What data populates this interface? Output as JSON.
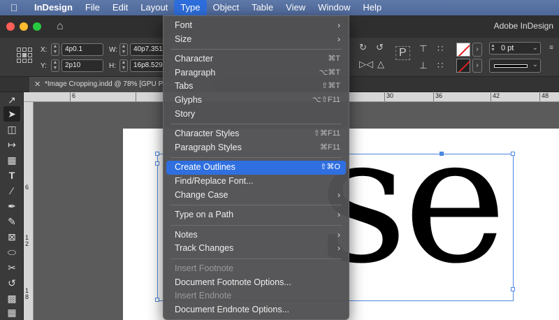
{
  "menubar": {
    "apple": "",
    "items": [
      "InDesign",
      "File",
      "Edit",
      "Layout",
      "Type",
      "Object",
      "Table",
      "View",
      "Window",
      "Help"
    ],
    "active": "Type"
  },
  "titlebar": {
    "app_title": "Adobe InDesign"
  },
  "control": {
    "x": {
      "label": "X:",
      "value": "4p0.1"
    },
    "y": {
      "label": "Y:",
      "value": "2p10"
    },
    "w": {
      "label": "W:",
      "value": "40p7.351"
    },
    "h": {
      "label": "H:",
      "value": "16p8.529"
    },
    "stroke_weight": "0 pt"
  },
  "tab": {
    "title": "*Image Cropping.indd @ 78% [GPU Preview]"
  },
  "ruler": {
    "top": [
      "6",
      "30",
      "36",
      "42",
      "48"
    ],
    "left": [
      "6",
      "12",
      "18"
    ]
  },
  "type_menu": {
    "items": [
      {
        "label": "Font",
        "shortcut": "",
        "submenu": true,
        "highlighted": false,
        "disabled": false
      },
      {
        "label": "Size",
        "shortcut": "",
        "submenu": true,
        "highlighted": false,
        "disabled": false
      },
      {
        "sep": true
      },
      {
        "label": "Character",
        "shortcut": "⌘T",
        "submenu": false,
        "highlighted": false,
        "disabled": false
      },
      {
        "label": "Paragraph",
        "shortcut": "⌥⌘T",
        "submenu": false,
        "highlighted": false,
        "disabled": false
      },
      {
        "label": "Tabs",
        "shortcut": "⇧⌘T",
        "submenu": false,
        "highlighted": false,
        "disabled": false
      },
      {
        "label": "Glyphs",
        "shortcut": "⌥⇧F11",
        "submenu": false,
        "highlighted": false,
        "disabled": false
      },
      {
        "label": "Story",
        "shortcut": "",
        "submenu": false,
        "highlighted": false,
        "disabled": false
      },
      {
        "sep": true
      },
      {
        "label": "Character Styles",
        "shortcut": "⇧⌘F11",
        "submenu": false,
        "highlighted": false,
        "disabled": false
      },
      {
        "label": "Paragraph Styles",
        "shortcut": "⌘F11",
        "submenu": false,
        "highlighted": false,
        "disabled": false
      },
      {
        "sep": true
      },
      {
        "label": "Create Outlines",
        "shortcut": "⇧⌘O",
        "submenu": false,
        "highlighted": true,
        "disabled": false
      },
      {
        "label": "Find/Replace Font...",
        "shortcut": "",
        "submenu": false,
        "highlighted": false,
        "disabled": false
      },
      {
        "label": "Change Case",
        "shortcut": "",
        "submenu": true,
        "highlighted": false,
        "disabled": false
      },
      {
        "sep": true
      },
      {
        "label": "Type on a Path",
        "shortcut": "",
        "submenu": true,
        "highlighted": false,
        "disabled": false
      },
      {
        "sep": true
      },
      {
        "label": "Notes",
        "shortcut": "",
        "submenu": true,
        "highlighted": false,
        "disabled": false
      },
      {
        "label": "Track Changes",
        "shortcut": "",
        "submenu": true,
        "highlighted": false,
        "disabled": false
      },
      {
        "sep": true
      },
      {
        "label": "Insert Footnote",
        "shortcut": "",
        "submenu": false,
        "highlighted": false,
        "disabled": true
      },
      {
        "label": "Document Footnote Options...",
        "shortcut": "",
        "submenu": false,
        "highlighted": false,
        "disabled": false
      },
      {
        "label": "Insert Endnote",
        "shortcut": "",
        "submenu": false,
        "highlighted": false,
        "disabled": true
      },
      {
        "label": "Document Endnote Options...",
        "shortcut": "",
        "submenu": false,
        "highlighted": false,
        "disabled": false
      }
    ]
  },
  "document": {
    "text": "se"
  },
  "colors": {
    "accent": "#2f6fe0",
    "menubar": "#5470a3",
    "frame": "#4c88e0"
  }
}
